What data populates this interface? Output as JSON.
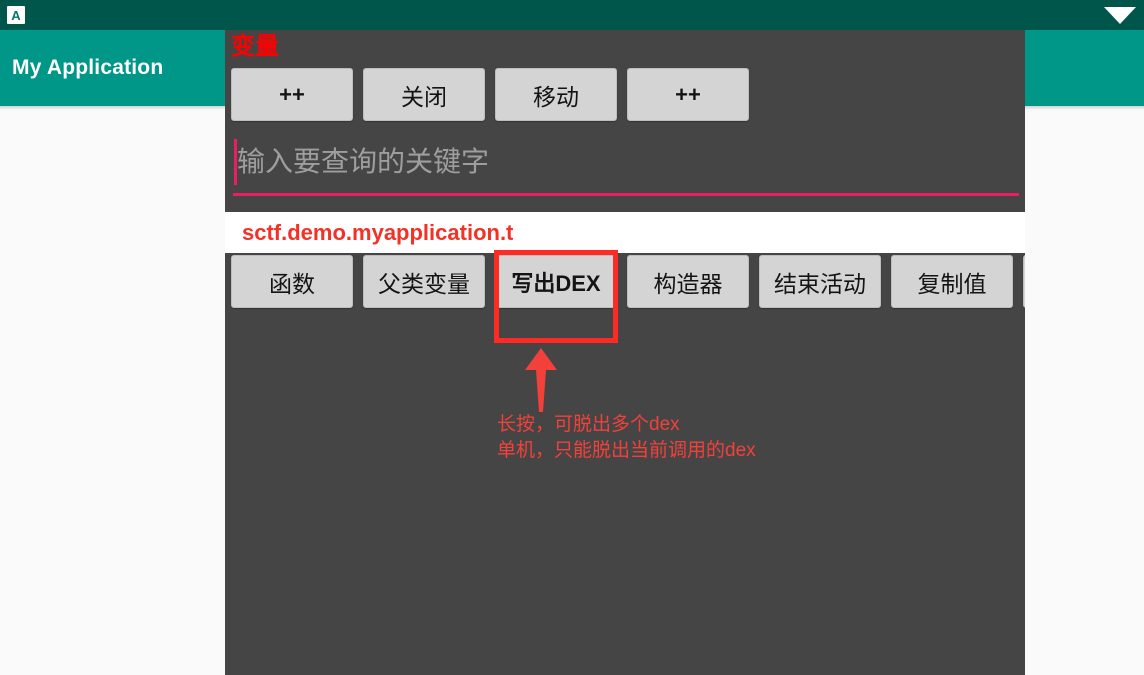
{
  "status_bar": {
    "app_icon": "app-letter-a-icon",
    "signal_icon": "wifi-triangle-icon"
  },
  "app_bar": {
    "title": "My Application",
    "background_color": "#009688"
  },
  "overlay_panel": {
    "background_color": "#454545",
    "section_label": "变量",
    "top_buttons": [
      {
        "label": "++",
        "cjk": false
      },
      {
        "label": "关闭",
        "cjk": true
      },
      {
        "label": "移动",
        "cjk": true
      },
      {
        "label": "++",
        "cjk": false
      }
    ],
    "search": {
      "value": "",
      "placeholder": "输入要查询的关键字",
      "accent_color": "#E91E63"
    },
    "result": {
      "text": "sctf.demo.myapplication.t",
      "text_color": "#F23127"
    },
    "bottom_buttons": [
      {
        "label": "函数",
        "cjk": true
      },
      {
        "label": "父类变量",
        "cjk": true
      },
      {
        "label": "写出DEX",
        "cjk": false
      },
      {
        "label": "构造器",
        "cjk": true
      },
      {
        "label": "结束活动",
        "cjk": true
      },
      {
        "label": "复制值",
        "cjk": true
      },
      {
        "label": "",
        "cjk": false
      }
    ]
  },
  "annotation": {
    "highlight_color": "#FF2A25",
    "arrow_icon": "up-arrow-icon",
    "lines": [
      "长按，可脱出多个dex",
      "单机，只能脱出当前调用的dex"
    ]
  }
}
